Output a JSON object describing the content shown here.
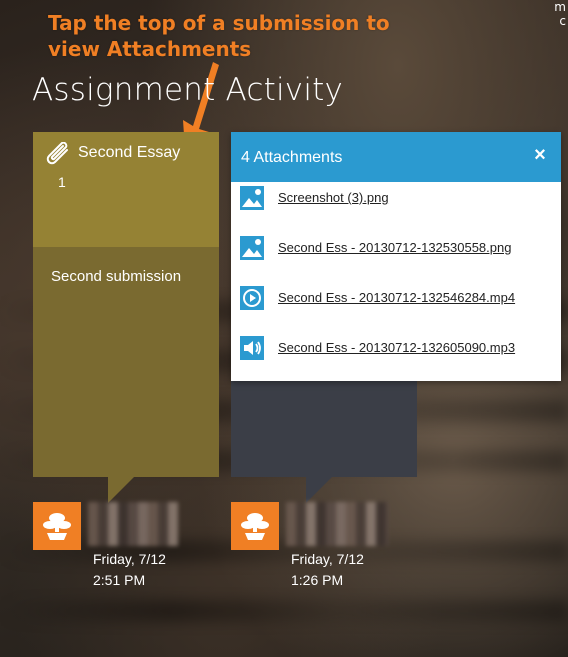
{
  "annotation": {
    "text": "Tap the top of a submission to view Attachments"
  },
  "corner_text": "m\nc",
  "page_title": "Assignment Activity",
  "cards": [
    {
      "title": "Second Essay",
      "count": "1",
      "body": "Second submission",
      "date": "Friday, 7/12",
      "time": "2:51 PM",
      "color": "#958234"
    },
    {
      "date": "Friday, 7/12",
      "time": "1:26 PM",
      "color": "#3b3e47"
    }
  ],
  "attachments_panel": {
    "title": "4 Attachments",
    "close_label": "×",
    "items": [
      {
        "name": "Screenshot (3).png",
        "icon": "image-file-icon"
      },
      {
        "name": "Second Ess - 20130712-132530558.png",
        "icon": "image-file-icon"
      },
      {
        "name": "Second Ess - 20130712-132546284.mp4",
        "icon": "video-file-icon"
      },
      {
        "name": "Second Ess - 20130712-132605090.mp3",
        "icon": "audio-file-icon"
      }
    ]
  },
  "colors": {
    "accent_orange": "#f07f24",
    "panel_header_blue": "#2b9ad0"
  }
}
